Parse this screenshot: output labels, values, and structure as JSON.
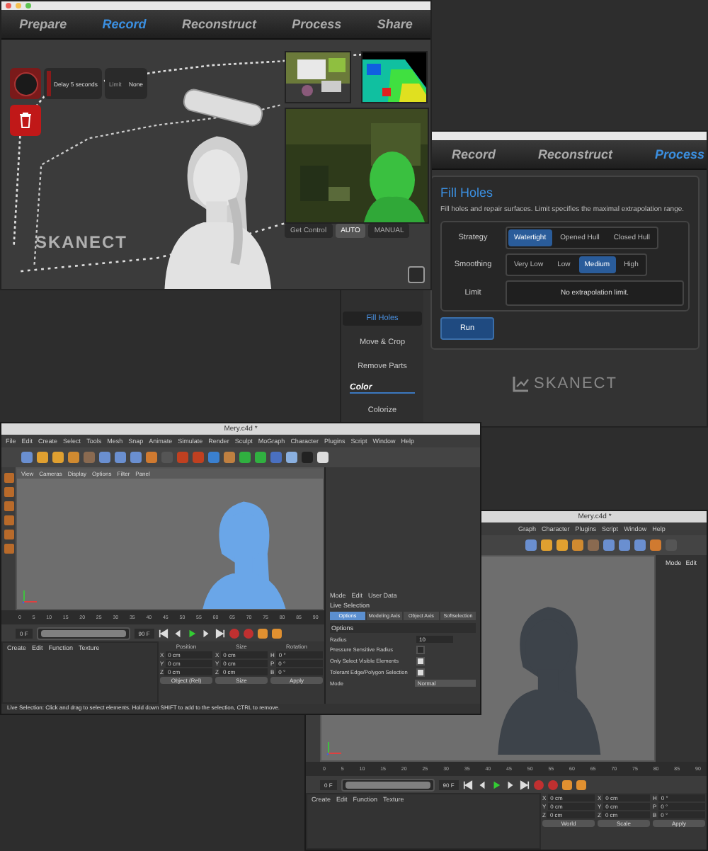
{
  "record_window": {
    "tabs": [
      {
        "label": "Prepare",
        "selected": false
      },
      {
        "label": "Record",
        "selected": true
      },
      {
        "label": "Reconstruct",
        "selected": false
      },
      {
        "label": "Process",
        "selected": false
      },
      {
        "label": "Share",
        "selected": false
      }
    ],
    "delay": "Delay 5 seconds",
    "limit_label": "Limit",
    "limit_value": "None",
    "camera_buttons": [
      {
        "label": "Get Control",
        "selected": false
      },
      {
        "label": "AUTO",
        "selected": true
      },
      {
        "label": "MANUAL",
        "selected": false
      }
    ],
    "logo": "SKANECT"
  },
  "process_window": {
    "tabs": [
      {
        "label": "Record",
        "selected": false
      },
      {
        "label": "Reconstruct",
        "selected": false
      },
      {
        "label": "Process",
        "selected": true
      }
    ],
    "panel": {
      "title": "Fill Holes",
      "description": "Fill holes and repair surfaces. Limit specifies the maximal extrapolation range.",
      "options": [
        {
          "label": "Strategy",
          "choices": [
            {
              "label": "Watertight",
              "selected": true
            },
            {
              "label": "Opened Hull",
              "selected": false
            },
            {
              "label": "Closed Hull",
              "selected": false
            }
          ]
        },
        {
          "label": "Smoothing",
          "choices": [
            {
              "label": "Very Low",
              "selected": false
            },
            {
              "label": "Low",
              "selected": false
            },
            {
              "label": "Medium",
              "selected": true
            },
            {
              "label": "High",
              "selected": false
            }
          ]
        }
      ],
      "limit": {
        "label": "Limit",
        "value": "No extrapolation limit."
      },
      "run_button": "Run"
    },
    "menu": [
      {
        "kind": "item",
        "label": "Fill Holes",
        "selected": true
      },
      {
        "kind": "item",
        "label": "Move & Crop",
        "selected": false
      },
      {
        "kind": "item",
        "label": "Remove Parts",
        "selected": false
      },
      {
        "kind": "section",
        "label": "Color"
      },
      {
        "kind": "item",
        "label": "Colorize",
        "selected": false
      }
    ],
    "logo": "SKANECT"
  },
  "c4d_windows": [
    {
      "title": "Mery.c4d *",
      "menus": [
        "File",
        "Edit",
        "Create",
        "Select",
        "Tools",
        "Mesh",
        "Snap",
        "Animate",
        "Simulate",
        "Render",
        "Sculpt",
        "MoGraph",
        "Character",
        "Plugins",
        "Script",
        "Window",
        "Help"
      ],
      "view_menus": [
        "View",
        "Cameras",
        "Display",
        "Options",
        "Filter",
        "Panel"
      ],
      "attributes": {
        "header": [
          "Mode",
          "Edit",
          "User Data"
        ],
        "tool": "Live Selection",
        "tabs": [
          {
            "label": "Options",
            "selected": true
          },
          {
            "label": "Modeling Axis",
            "selected": false
          },
          {
            "label": "Object Axis",
            "selected": false
          },
          {
            "label": "Softselection",
            "selected": false
          }
        ],
        "section": "Options",
        "fields": [
          {
            "kind": "number",
            "label": "Radius",
            "value": "10"
          },
          {
            "kind": "checkbox",
            "label": "Pressure Sensitive Radius",
            "checked": false
          },
          {
            "kind": "checkbox",
            "label": "Only Select Visible Elements",
            "checked": true
          },
          {
            "kind": "checkbox",
            "label": "Tolerant Edge/Polygon Selection",
            "checked": true
          },
          {
            "kind": "select",
            "label": "Mode",
            "value": "Normal"
          }
        ]
      },
      "ticks": [
        "0",
        "5",
        "10",
        "15",
        "20",
        "25",
        "30",
        "35",
        "40",
        "45",
        "50",
        "55",
        "60",
        "65",
        "70",
        "75",
        "80",
        "85",
        "90"
      ],
      "frame_start": "0 F",
      "frame_end": "90 F",
      "frame_slider": {
        "level": 1
      },
      "bottom_menu": [
        "Create",
        "Edit",
        "Function",
        "Texture"
      ],
      "coords": {
        "headers": [
          "Position",
          "Size",
          "Rotation"
        ],
        "rows": [
          [
            {
              "axis": "X",
              "value": "0 cm"
            },
            {
              "axis": "X",
              "value": "0 cm"
            },
            {
              "axis": "H",
              "value": "0 °"
            }
          ],
          [
            {
              "axis": "Y",
              "value": "0 cm"
            },
            {
              "axis": "Y",
              "value": "0 cm"
            },
            {
              "axis": "P",
              "value": "0 °"
            }
          ],
          [
            {
              "axis": "Z",
              "value": "0 cm"
            },
            {
              "axis": "Z",
              "value": "0 cm"
            },
            {
              "axis": "B",
              "value": "0 °"
            }
          ]
        ],
        "buttons": [
          "Object (Rel)",
          "Size",
          "Apply"
        ]
      },
      "status": "Live Selection: Click and drag to select elements. Hold down SHIFT to add to the selection, CTRL to remove."
    },
    {
      "title": "Mery.c4d *",
      "menus": [
        "Graph",
        "Character",
        "Plugins",
        "Script",
        "Window",
        "Help"
      ],
      "side_header": [
        "Mode",
        "Edit"
      ],
      "ticks": [
        "0",
        "5",
        "10",
        "15",
        "20",
        "25",
        "30",
        "35",
        "40",
        "45",
        "50",
        "55",
        "60",
        "65",
        "70",
        "75",
        "80",
        "85",
        "90"
      ],
      "frame_start": "0 F",
      "frame_end": "90 F",
      "frame_slider": {
        "level": 1
      },
      "bottom_menu": [
        "Create",
        "Edit",
        "Function",
        "Texture"
      ],
      "coords": {
        "rows": [
          [
            {
              "axis": "X",
              "value": "0 cm"
            },
            {
              "axis": "X",
              "value": "0 cm"
            },
            {
              "axis": "H",
              "value": "0 °"
            }
          ],
          [
            {
              "axis": "Y",
              "value": "0 cm"
            },
            {
              "axis": "Y",
              "value": "0 cm"
            },
            {
              "axis": "P",
              "value": "0 °"
            }
          ],
          [
            {
              "axis": "Z",
              "value": "0 cm"
            },
            {
              "axis": "Z",
              "value": "0 cm"
            },
            {
              "axis": "B",
              "value": "0 °"
            }
          ]
        ],
        "buttons": [
          "World",
          "Scale",
          "Apply"
        ]
      }
    }
  ]
}
